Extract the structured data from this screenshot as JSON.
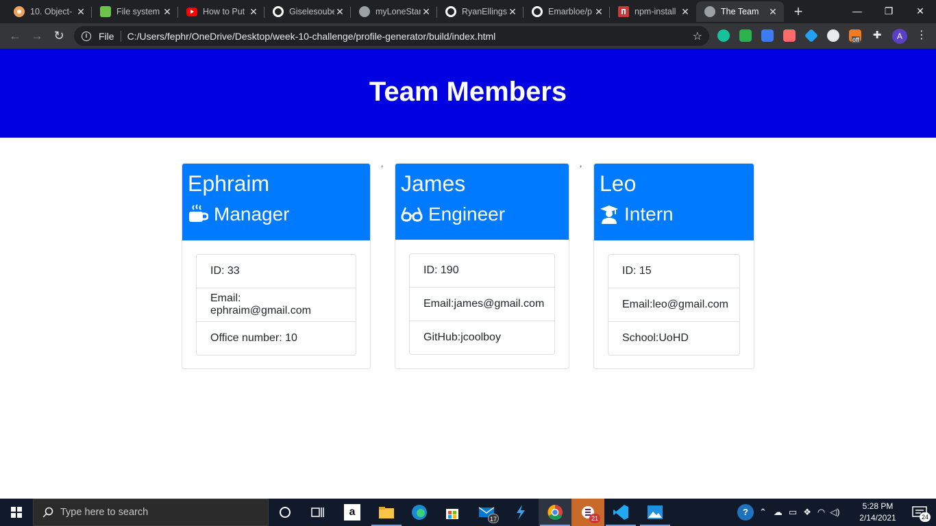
{
  "browser": {
    "tabs": [
      {
        "title": "10. Object-",
        "icon": "generic-globe-icon",
        "color": "#f0a45b"
      },
      {
        "title": "File system",
        "icon": "nodejs-icon",
        "color": "#6cc24a"
      },
      {
        "title": "How to Put",
        "icon": "youtube-icon",
        "color": "#ff0000"
      },
      {
        "title": "Giselesoube",
        "icon": "github-icon",
        "color": "#ffffff"
      },
      {
        "title": "myLoneStar",
        "icon": "globe-icon",
        "color": "#9aa0a6"
      },
      {
        "title": "RyanEllings",
        "icon": "github-icon",
        "color": "#ffffff"
      },
      {
        "title": "Emarbloe/p",
        "icon": "github-icon",
        "color": "#ffffff"
      },
      {
        "title": "npm-install",
        "icon": "npm-icon",
        "color": "#cb3837"
      },
      {
        "title": "The Team",
        "icon": "globe-icon",
        "color": "#9aa0a6",
        "active": true
      }
    ],
    "new_tab_label": "+",
    "window_controls": {
      "minimize": "—",
      "maximize": "❐",
      "close": "✕"
    },
    "omnibox": {
      "scheme_label": "File",
      "url": "C:/Users/fephr/OneDrive/Desktop/week-10-challenge/profile-generator/build/index.html"
    },
    "profile_initial": "A",
    "extensions": [
      {
        "name": "grammarly-icon",
        "color": "#15c39a"
      },
      {
        "name": "feedly-icon",
        "color": "#2bb24c"
      },
      {
        "name": "notebook-icon",
        "color": "#3d7cf5"
      },
      {
        "name": "screencast-icon",
        "color": "#ff6b6b"
      },
      {
        "name": "diamond-icon",
        "color": "#21a1f1"
      },
      {
        "name": "circle-icon",
        "color": "#e8eaed"
      },
      {
        "name": "rss-off-icon",
        "color": "#f07b22"
      },
      {
        "name": "puzzle-icon",
        "color": "#e8eaed"
      }
    ],
    "ext_off_label": "off"
  },
  "page": {
    "header_title": "Team Members",
    "stray_marks": [
      ",",
      ","
    ],
    "cards": [
      {
        "name": "Ephraim",
        "role": "Manager",
        "role_icon": "coffee-mug-icon",
        "details": [
          "ID: 33",
          "Email: ephraim@gmail.com",
          "Office number: 10"
        ]
      },
      {
        "name": "James",
        "role": "Engineer",
        "role_icon": "glasses-icon",
        "details": [
          "ID: 190",
          "Email:james@gmail.com",
          "GitHub:jcoolboy"
        ]
      },
      {
        "name": "Leo",
        "role": "Intern",
        "role_icon": "graduate-icon",
        "details": [
          "ID: 15",
          "Email:leo@gmail.com",
          "School:UoHD"
        ]
      }
    ],
    "colors": {
      "header_bg": "#0000e0",
      "card_head_bg": "#007bff"
    }
  },
  "taskbar": {
    "search_placeholder": "Type here to search",
    "mail_badge": "17",
    "slack_badge": "21",
    "clock_time": "5:28 PM",
    "clock_date": "2/14/2021",
    "notification_count": "24"
  }
}
